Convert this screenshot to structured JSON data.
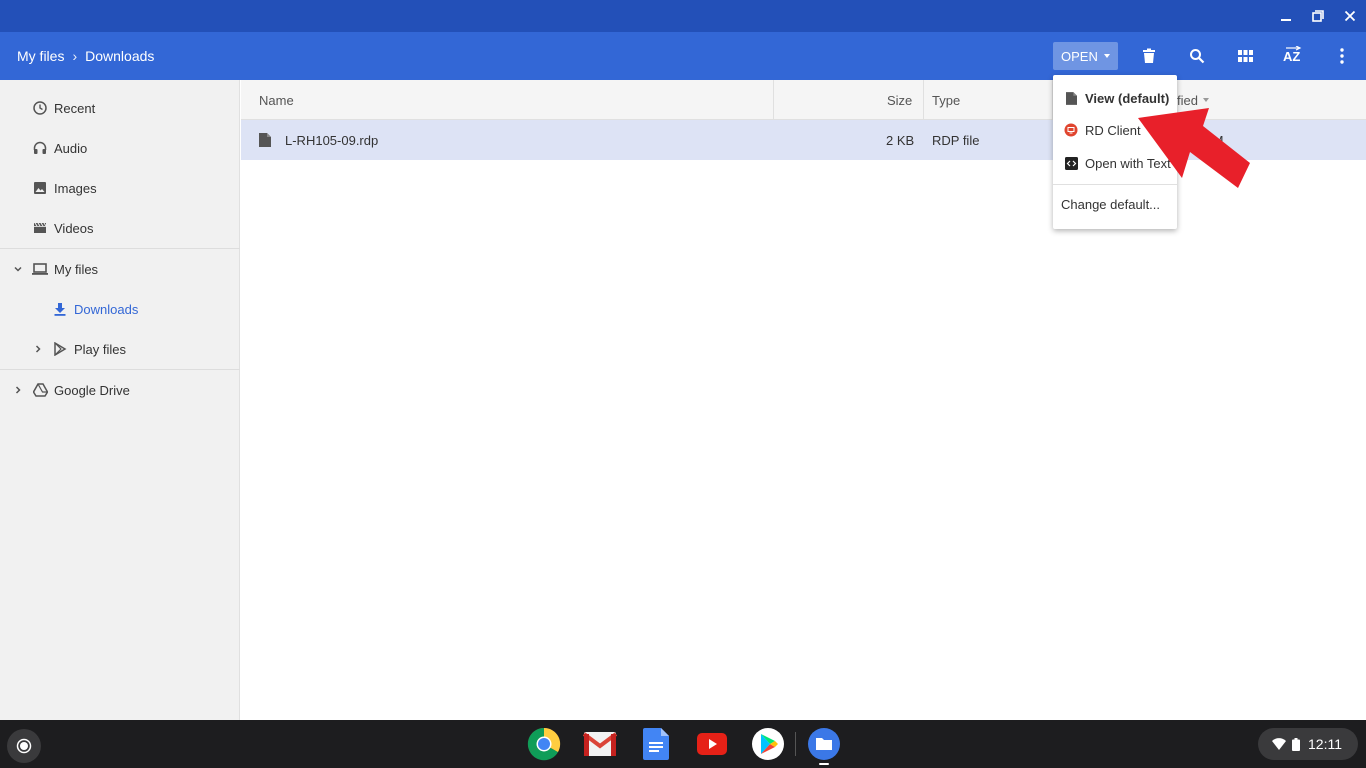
{
  "breadcrumb": {
    "root": "My files",
    "current": "Downloads"
  },
  "toolbar": {
    "open_label": "OPEN"
  },
  "sidebar": {
    "recent": "Recent",
    "audio": "Audio",
    "images": "Images",
    "videos": "Videos",
    "my_files": "My files",
    "downloads": "Downloads",
    "play_files": "Play files",
    "google_drive": "Google Drive"
  },
  "columns": {
    "name": "Name",
    "size": "Size",
    "type": "Type",
    "modified": "fied"
  },
  "files": [
    {
      "name": "L-RH105-09.rdp",
      "size": "2 KB",
      "type": "RDP file",
      "modified": "PM"
    }
  ],
  "open_menu": {
    "view_default": "View (default)",
    "rd_client": "RD Client",
    "open_with_text": "Open with Text",
    "change_default": "Change default..."
  },
  "status": {
    "time": "12:11"
  },
  "colors": {
    "titlebar": "#2350b8",
    "toolbar": "#3367d6",
    "selected_row": "#dde3f5",
    "arrow": "#e8202a"
  }
}
